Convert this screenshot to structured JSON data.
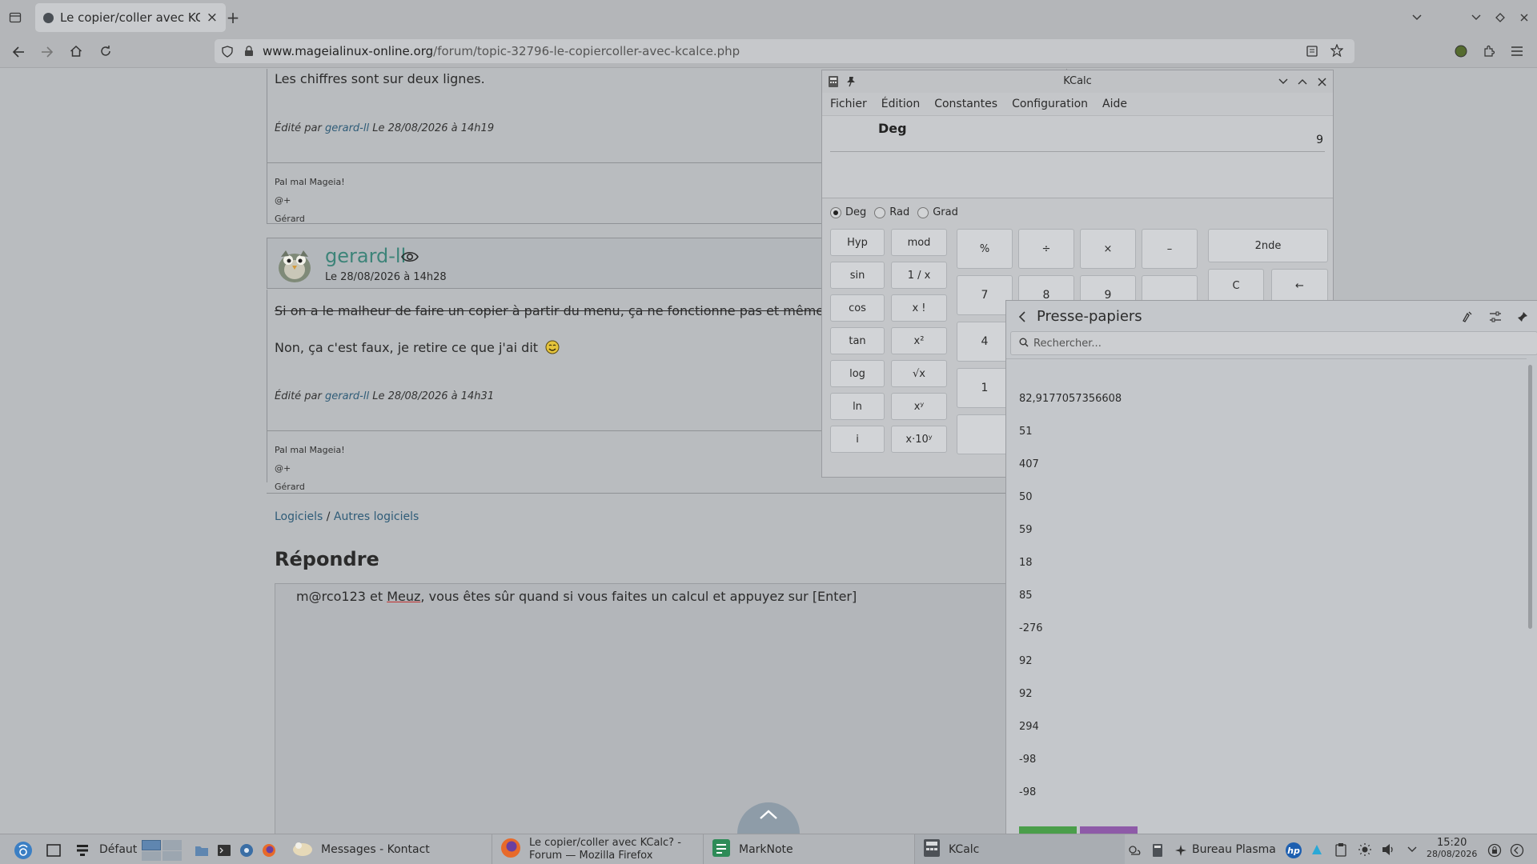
{
  "browser": {
    "tab_title": "Le copier/coller avec KCa",
    "url_host": "www.mageialinux-online.org",
    "url_path": "/forum/topic-32796-le-copiercoller-avec-kcalce.php"
  },
  "post1": {
    "text": "Les chiffres sont sur deux lignes.",
    "edited_prefix": "Édité par",
    "edited_author": "gerard-ll",
    "edited_date": "Le 28/08/2026 à 14h19",
    "sig": [
      "Pal mal Mageia!",
      "@+",
      "Gérard"
    ]
  },
  "post2": {
    "author": "gerard-ll",
    "date": "Le 28/08/2026 à 14h28",
    "line1": "Si on a le malheur de faire un copier à partir du menu, ça ne fonctionne pas et même la co",
    "line2": "Non, ça c'est faux, je retire ce que j'ai dit",
    "edited_prefix": "Édité par",
    "edited_author": "gerard-ll",
    "edited_date": "Le 28/08/2026 à 14h31",
    "sig": [
      "Pal mal Mageia!",
      "@+",
      "Gérard"
    ]
  },
  "breadcrumb": {
    "a": "Logiciels",
    "sep": " / ",
    "b": "Autres logiciels"
  },
  "reply": {
    "title": "Répondre",
    "text_a": "m@rco123 et ",
    "text_b": "Meuz",
    "text_c": ", vous êtes sûr quand si vous faites un calcul et appuyez sur [Enter]"
  },
  "kcalc": {
    "title": "KCalc",
    "menu": [
      "Fichier",
      "Édition",
      "Constantes",
      "Configuration",
      "Aide"
    ],
    "mode": "Deg",
    "value": "9",
    "angle": [
      "Deg",
      "Rad",
      "Grad"
    ],
    "sci_left": [
      "Hyp",
      "sin",
      "cos",
      "tan",
      "log",
      "ln",
      "i"
    ],
    "sci_right": [
      "mod",
      "1 / x",
      "x !",
      "x²",
      "√x",
      "xʸ",
      "x·10ʸ"
    ],
    "ops": [
      "%",
      "÷",
      "×",
      "–"
    ],
    "nums": [
      "7",
      "8",
      "9",
      "4",
      "1"
    ],
    "btn_2nd": "2nde",
    "btn_c": "C",
    "btn_back": "←"
  },
  "clipboard": {
    "title": "Presse-papiers",
    "search_placeholder": "Rechercher...",
    "items": [
      "82,9177057356608",
      "51",
      "407",
      "50",
      "59",
      "18",
      "85",
      "-276",
      "92",
      "92",
      "294",
      "-98",
      "-98"
    ]
  },
  "taskbar": {
    "activity": "Défaut",
    "tasks": [
      "Messages - Kontact",
      "Le copier/coller avec KCalc? - ",
      "Forum — Mozilla Firefox",
      "MarkNote",
      "KCalc"
    ],
    "desktop": "Bureau Plasma",
    "time": "15:20",
    "date": "28/08/2026"
  }
}
